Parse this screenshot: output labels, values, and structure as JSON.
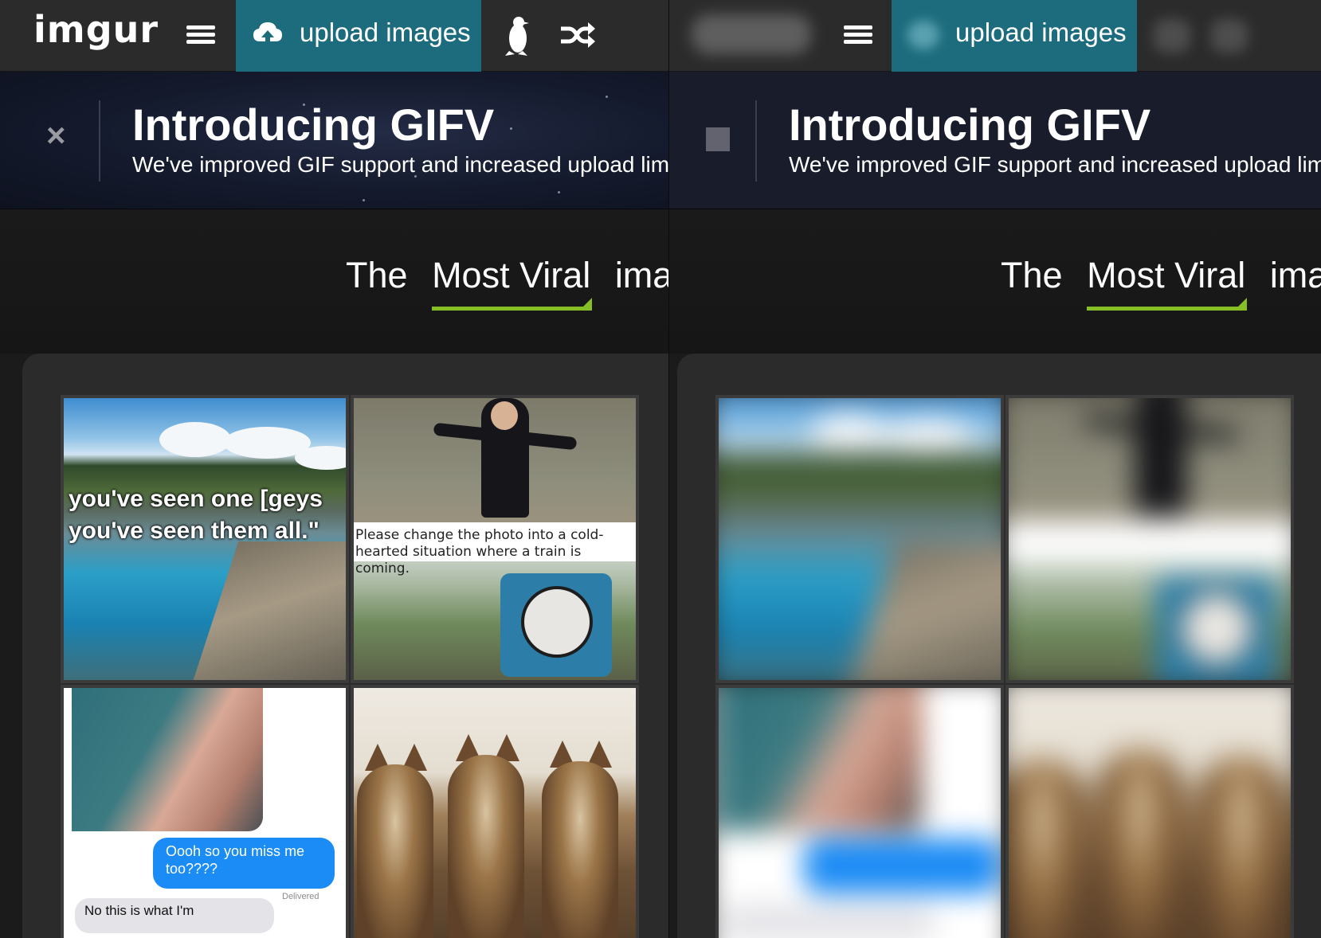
{
  "left": {
    "logo": "imgur",
    "upload_label": "upload images",
    "banner": {
      "title": "Introducing GIFV",
      "subtitle": "We've improved GIF support and increased upload lim"
    },
    "heading": {
      "w1": "The",
      "highlight": "Most Viral",
      "w3": "imag"
    },
    "tiles": {
      "geyser_line1": "you've seen one [geys",
      "geyser_line2": "you've seen them all.\"",
      "train_caption": "Please change the photo into a cold-hearted situation where a train is coming.",
      "chat_bubble": "Oooh so you miss me too????",
      "chat_delivered": "Delivered",
      "chat_reply": "No this is what I'm"
    }
  },
  "right": {
    "upload_label": "upload images",
    "banner": {
      "title": "Introducing GIFV",
      "subtitle": "We've improved GIF support and increased upload lim"
    },
    "heading": {
      "w1": "The",
      "highlight": "Most Viral",
      "w3": "imag"
    }
  },
  "colors": {
    "topbar": "#2b2b2b",
    "upload_button": "#1c6c7d",
    "accent_green": "#85bf25",
    "gallery_bg": "#2b2b2b"
  },
  "icons": [
    "menu-icon",
    "upload-cloud-icon",
    "penguin-icon",
    "shuffle-icon",
    "close-icon"
  ]
}
